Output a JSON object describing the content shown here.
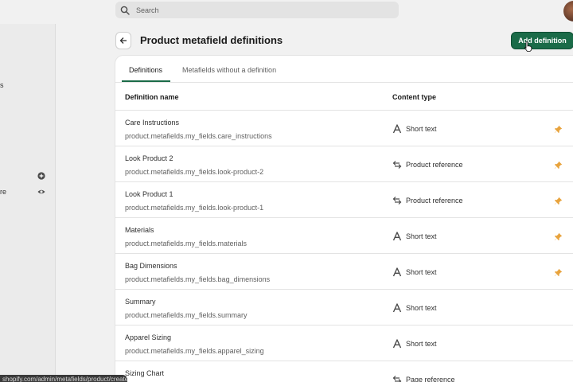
{
  "search": {
    "placeholder": "Search"
  },
  "sidebar": {
    "fragments": [
      "s",
      "re"
    ]
  },
  "header": {
    "title": "Product metafield definitions",
    "add_button": "Add definition"
  },
  "tabs": [
    {
      "label": "Definitions",
      "active": true
    },
    {
      "label": "Metafields without a definition",
      "active": false
    }
  ],
  "table": {
    "columns": [
      "Definition name",
      "Content type"
    ],
    "rows": [
      {
        "name": "Care Instructions",
        "key": "product.metafields.my_fields.care_instructions",
        "type": "Short text",
        "type_icon": "text-icon",
        "pinned": true
      },
      {
        "name": "Look Product 2",
        "key": "product.metafields.my_fields.look-product-2",
        "type": "Product reference",
        "type_icon": "reference-icon",
        "pinned": true
      },
      {
        "name": "Look Product 1",
        "key": "product.metafields.my_fields.look-product-1",
        "type": "Product reference",
        "type_icon": "reference-icon",
        "pinned": true
      },
      {
        "name": "Materials",
        "key": "product.metafields.my_fields.materials",
        "type": "Short text",
        "type_icon": "text-icon",
        "pinned": true
      },
      {
        "name": "Bag Dimensions",
        "key": "product.metafields.my_fields.bag_dimensions",
        "type": "Short text",
        "type_icon": "text-icon",
        "pinned": true
      },
      {
        "name": "Summary",
        "key": "product.metafields.my_fields.summary",
        "type": "Short text",
        "type_icon": "text-icon",
        "pinned": false
      },
      {
        "name": "Apparel Sizing",
        "key": "product.metafields.my_fields.apparel_sizing",
        "type": "Short text",
        "type_icon": "text-icon",
        "pinned": false
      },
      {
        "name": "Sizing Chart",
        "key": "",
        "type": "Page reference",
        "type_icon": "reference-icon",
        "pinned": false
      }
    ]
  },
  "status_url": "shopify.com/admin/metafields/product/create",
  "colors": {
    "accent": "#1a6b48",
    "pin": "#e8a33d"
  }
}
